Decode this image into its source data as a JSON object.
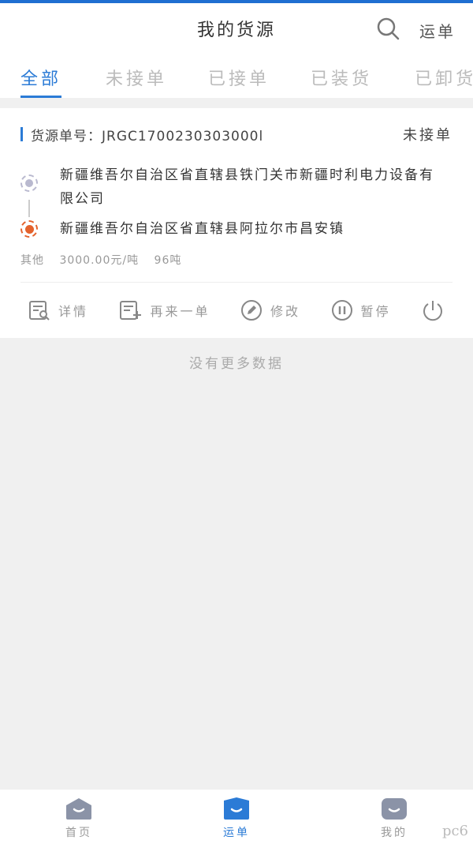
{
  "header": {
    "title": "我的货源",
    "waybill_link": "运单"
  },
  "tabs": [
    {
      "label": "全部",
      "active": true
    },
    {
      "label": "未接单",
      "active": false
    },
    {
      "label": "已接单",
      "active": false
    },
    {
      "label": "已装货",
      "active": false
    },
    {
      "label": "已卸货",
      "active": false
    }
  ],
  "card": {
    "order_no": "货源单号：JRGC1700230303000l",
    "status": "未接单",
    "from_address": "新疆维吾尔自治区省直辖县铁门关市新疆时利电力设备有限公司",
    "to_address": "新疆维吾尔自治区省直辖县阿拉尔市昌安镇",
    "cargo_type": "其他",
    "price": "3000.00元/吨",
    "weight": "96吨",
    "actions": {
      "detail": "详情",
      "reorder": "再来一单",
      "edit": "修改",
      "pause": "暂停"
    }
  },
  "no_more": "没有更多数据",
  "bottom_nav": [
    {
      "label": "首页",
      "icon": "home-icon",
      "active": false
    },
    {
      "label": "运单",
      "icon": "waybill-icon",
      "active": true
    },
    {
      "label": "我的",
      "icon": "profile-icon",
      "active": false
    }
  ],
  "watermark": "pc6",
  "colors": {
    "accent": "#2b7bd6",
    "origin_dot": "#b9b9cf",
    "destination_dot": "#e4622c"
  }
}
